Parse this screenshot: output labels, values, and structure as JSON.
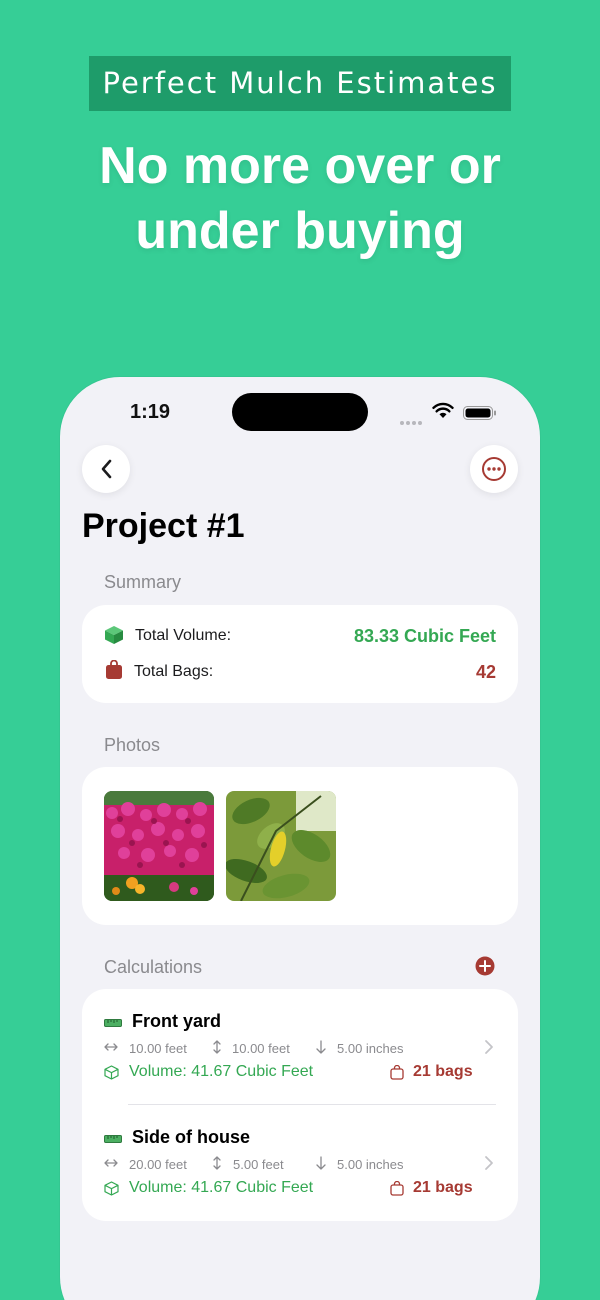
{
  "promo": {
    "tagline": "Perfect Mulch Estimates",
    "headline_line1": "No more over or",
    "headline_line2": "under buying"
  },
  "status_bar": {
    "time": "1:19"
  },
  "page": {
    "title": "Project #1"
  },
  "summary": {
    "section_label": "Summary",
    "volume_label": "Total Volume:",
    "volume_value": "83.33 Cubic Feet",
    "bags_label": "Total Bags:",
    "bags_value": "42"
  },
  "photos": {
    "section_label": "Photos",
    "items": [
      "flower-bed-photo",
      "leaves-photo"
    ]
  },
  "calculations": {
    "section_label": "Calculations",
    "items": [
      {
        "name": "Front yard",
        "length": "10.00 feet",
        "width": "10.00 feet",
        "depth": "5.00 inches",
        "volume": "Volume: 41.67 Cubic Feet",
        "bags": "21 bags"
      },
      {
        "name": "Side of house",
        "length": "20.00 feet",
        "width": "5.00 feet",
        "depth": "5.00 inches",
        "volume": "Volume: 41.67 Cubic Feet",
        "bags": "21 bags"
      }
    ]
  },
  "icons": {
    "back": "chevron-left-icon",
    "more": "ellipsis-circle-icon",
    "volume": "cube-icon",
    "bags": "bag-icon",
    "add": "plus-circle-icon",
    "length": "arrow-left-right-icon",
    "width": "arrow-up-down-icon",
    "depth": "arrow-down-icon",
    "disclosure": "chevron-right-icon"
  },
  "colors": {
    "background": "#36CE96",
    "tagline_bg": "#1E9C6A",
    "accent_green": "#34A853",
    "accent_red": "#A63A33"
  }
}
